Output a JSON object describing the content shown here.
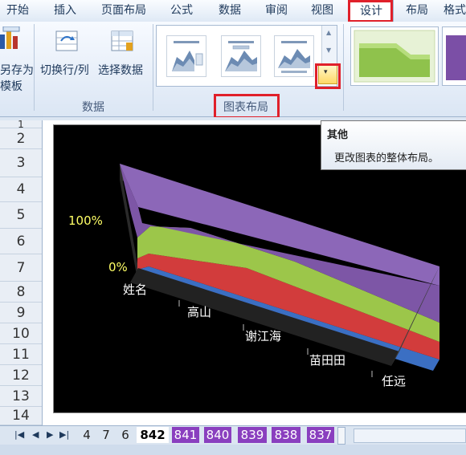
{
  "ribbon_tabs": [
    {
      "label": "开始"
    },
    {
      "label": "插入"
    },
    {
      "label": "页面布局"
    },
    {
      "label": "公式"
    },
    {
      "label": "数据"
    },
    {
      "label": "审阅"
    },
    {
      "label": "视图"
    },
    {
      "label": "设计"
    },
    {
      "label": "布局"
    },
    {
      "label": "格式"
    }
  ],
  "ribbon": {
    "save_as_template_line1": "另存为",
    "save_as_template_line2": "模板",
    "switch_row_col": "切换行/列",
    "select_data": "选择数据",
    "group_data_label": "数据",
    "group_layout_label": "图表布局"
  },
  "tooltip": {
    "title": "其他",
    "description": "更改图表的整体布局。"
  },
  "row_numbers": [
    "1",
    "2",
    "3",
    "4",
    "5",
    "6",
    "7",
    "8",
    "9",
    "10",
    "11",
    "12",
    "13",
    "14"
  ],
  "chart_data": {
    "type": "area",
    "categories": [
      "姓名",
      "高山",
      "谢江海",
      "苗田田",
      "任远"
    ],
    "y_tick_labels": [
      "100%",
      "0%"
    ],
    "series_colors": [
      "#3b6fc3",
      "#d23c3c",
      "#9cc64a",
      "#7d56a6"
    ]
  },
  "sheet_tabs": [
    {
      "label": "4"
    },
    {
      "label": "7"
    },
    {
      "label": "6"
    },
    {
      "label": "842"
    },
    {
      "label": "841"
    },
    {
      "label": "840"
    },
    {
      "label": "839"
    },
    {
      "label": "838"
    },
    {
      "label": "837"
    }
  ],
  "colors": {
    "highlight_red": "#e0202a",
    "sheet_purple": "#8a3fbf"
  }
}
